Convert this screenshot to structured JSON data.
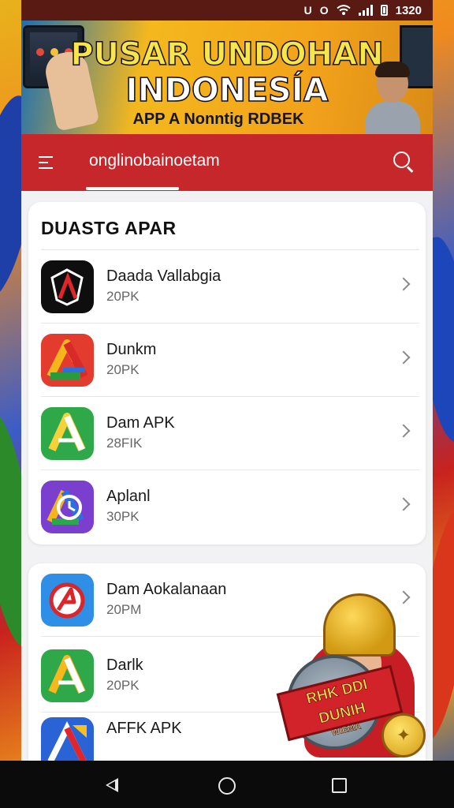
{
  "status_bar": {
    "time": "1320",
    "icon_1": "U",
    "icon_2": "O",
    "icons": [
      "notification-icon",
      "notification-icon",
      "wifi-icon",
      "signal-icon",
      "battery-icon"
    ]
  },
  "banner": {
    "title_line1": "PUSAR UNDOHAN",
    "title_line2": "INDONESÍA",
    "subtitle": "APP A Nonntig RDBEK"
  },
  "app_bar": {
    "title": "onglinobainoetam",
    "color": "#c6272a"
  },
  "section_1": {
    "title": "DUASTG APAR",
    "items": [
      {
        "name": "Daada Vallabgia",
        "size": "20PK"
      },
      {
        "name": "Dunkm",
        "size": "20PK"
      },
      {
        "name": "Dam APK",
        "size": "28FIK"
      },
      {
        "name": "Aplanl",
        "size": "30PK"
      }
    ]
  },
  "section_2": {
    "items": [
      {
        "name": "Dam Aokalanaan",
        "size": "20PM"
      },
      {
        "name": "Darlk",
        "size": "20PK"
      },
      {
        "name": "AFFK APK",
        "size": ""
      }
    ]
  },
  "mascot": {
    "ribbon_text": "RHK DDI DUNIH",
    "ribbon_sub": "WIEMA"
  },
  "nav_bar": {
    "icons": [
      "back-icon",
      "home-icon",
      "recents-icon"
    ]
  }
}
